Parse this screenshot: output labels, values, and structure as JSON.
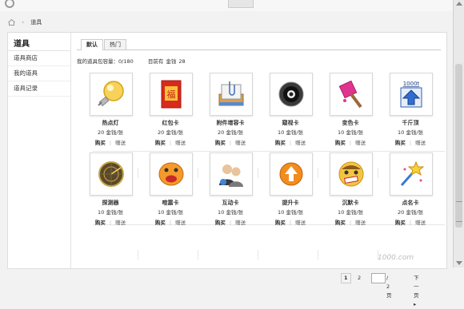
{
  "breadcrumb": {
    "current": "道具",
    "separator": "›"
  },
  "sidebar": {
    "title": "道具",
    "items": [
      {
        "label": "道具商店"
      },
      {
        "label": "我的道具"
      },
      {
        "label": "道具记录"
      }
    ]
  },
  "tabs": [
    {
      "label": "默认"
    },
    {
      "label": "热门"
    }
  ],
  "info": {
    "capacity": "我的道具包容量：0/180",
    "balance_label": "目前有",
    "currency": "金钱",
    "balance": "28"
  },
  "items": [
    {
      "name": "热点灯",
      "price": "20",
      "currency": "金钱/张",
      "buy": "购买",
      "gift": "赠送",
      "icon": "bulb-icon"
    },
    {
      "name": "红包卡",
      "price": "20",
      "currency": "金钱/张",
      "buy": "购买",
      "gift": "赠送",
      "icon": "red-envelope-icon",
      "glyph": "福"
    },
    {
      "name": "附件增容卡",
      "price": "20",
      "currency": "金钱/张",
      "buy": "购买",
      "gift": "赠送",
      "icon": "attachment-icon"
    },
    {
      "name": "窥视卡",
      "price": "10",
      "currency": "金钱/张",
      "buy": "购买",
      "gift": "赠送",
      "icon": "eye-icon"
    },
    {
      "name": "变色卡",
      "price": "10",
      "currency": "金钱/张",
      "buy": "购买",
      "gift": "赠送",
      "icon": "paint-icon"
    },
    {
      "name": "千斤顶",
      "price": "10",
      "currency": "金钱/张",
      "buy": "购买",
      "gift": "赠送",
      "icon": "jack-icon",
      "glyph": "1000t"
    },
    {
      "name": "探测器",
      "price": "10",
      "currency": "金钱/张",
      "buy": "购买",
      "gift": "赠送",
      "icon": "radar-icon"
    },
    {
      "name": "喧嚣卡",
      "price": "10",
      "currency": "金钱/张",
      "buy": "购买",
      "gift": "赠送",
      "icon": "shout-icon"
    },
    {
      "name": "互动卡",
      "price": "10",
      "currency": "金钱/张",
      "buy": "购买",
      "gift": "赠送",
      "icon": "users-icon"
    },
    {
      "name": "提升卡",
      "price": "10",
      "currency": "金钱/张",
      "buy": "购买",
      "gift": "赠送",
      "icon": "up-arrow-icon"
    },
    {
      "name": "沉默卡",
      "price": "10",
      "currency": "金钱/张",
      "buy": "购买",
      "gift": "赠送",
      "icon": "mute-icon"
    },
    {
      "name": "点名卡",
      "price": "20",
      "currency": "金钱/张",
      "buy": "购买",
      "gift": "赠送",
      "icon": "wand-icon"
    }
  ],
  "pager": {
    "pages": [
      "1",
      "2"
    ],
    "current": "1",
    "input_value": "",
    "total": "/ 2 页",
    "next": "下一页"
  },
  "watermark": "1000.com"
}
